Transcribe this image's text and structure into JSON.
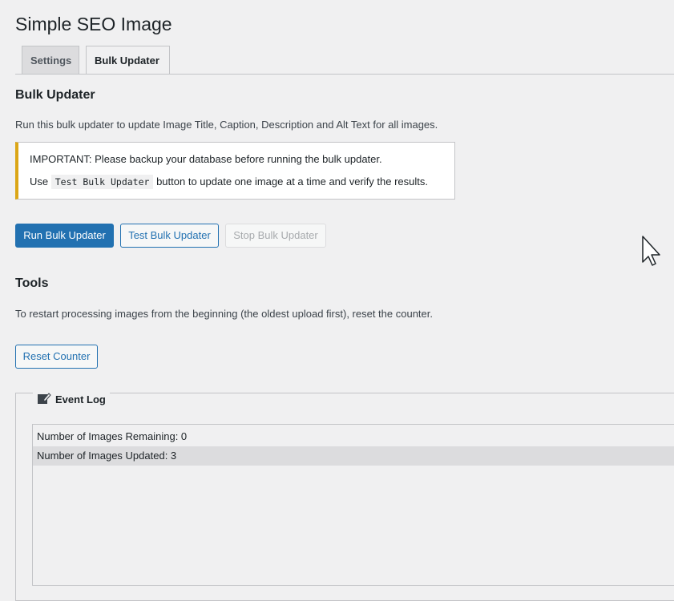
{
  "page": {
    "title": "Simple SEO Image"
  },
  "tabs": [
    {
      "label": "Settings",
      "active": false
    },
    {
      "label": "Bulk Updater",
      "active": true
    }
  ],
  "bulk": {
    "heading": "Bulk Updater",
    "description": "Run this bulk updater to update Image Title, Caption, Description and Alt Text for all images.",
    "notice": {
      "line1": "IMPORTANT: Please backup your database before running the bulk updater.",
      "line2_prefix": "Use",
      "line2_code": "Test Bulk Updater",
      "line2_suffix": "button to update one image at a time and verify the results."
    },
    "buttons": {
      "run": "Run Bulk Updater",
      "test": "Test Bulk Updater",
      "stop": "Stop Bulk Updater"
    }
  },
  "tools": {
    "heading": "Tools",
    "description": "To restart processing images from the beginning (the oldest upload first), reset the counter.",
    "reset_button": "Reset Counter"
  },
  "event_log": {
    "legend": "Event Log",
    "rows": [
      "Number of Images Remaining: 0",
      "Number of Images Updated: 3"
    ]
  },
  "colors": {
    "primary": "#2271b1",
    "notice_border": "#dba617",
    "background": "#f0f0f1"
  },
  "icons": {
    "legend_icon": "edit-icon",
    "cursor": "mouse-pointer-icon"
  }
}
